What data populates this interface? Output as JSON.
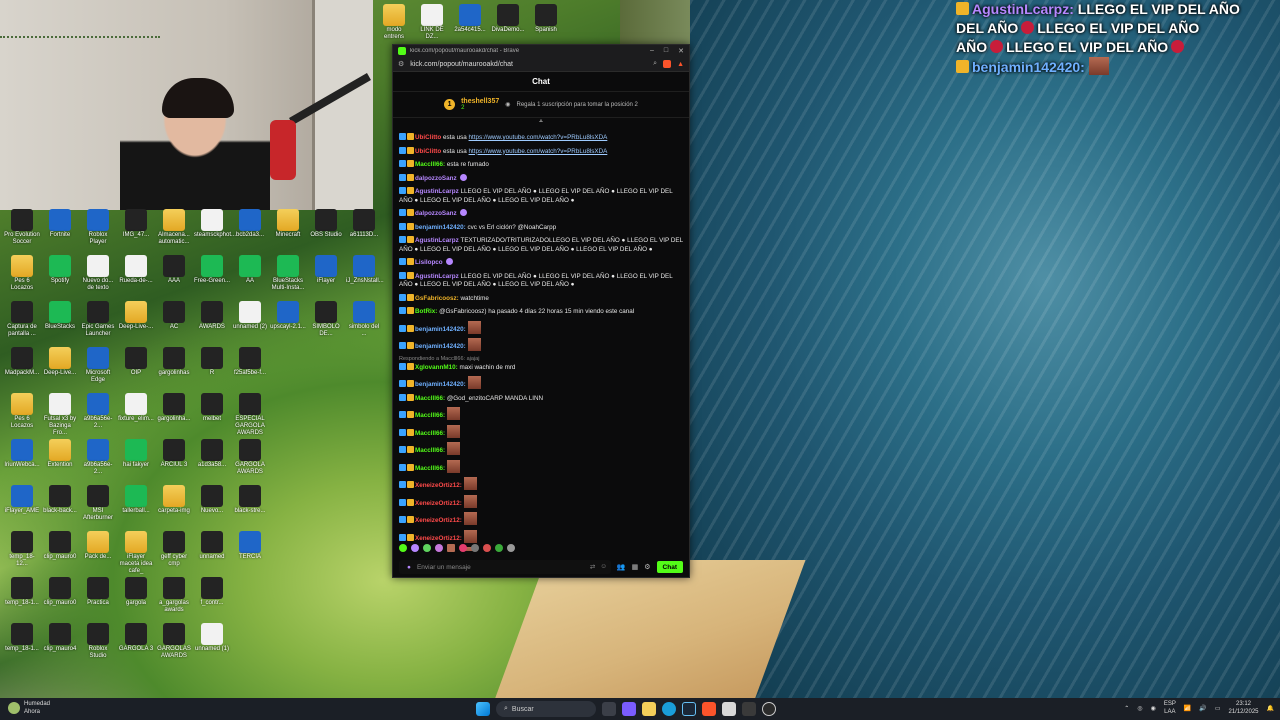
{
  "desktop": {
    "icons": [
      {
        "label": "Pro Evolution Soccer",
        "kind": "dark"
      },
      {
        "label": "Fortnite",
        "kind": "blue"
      },
      {
        "label": "Roblox Player",
        "kind": "blue"
      },
      {
        "label": "IMG_47...",
        "kind": "dark"
      },
      {
        "label": "Almacena... automatic...",
        "kind": "folder"
      },
      {
        "label": "steamsckphot...",
        "kind": "file"
      },
      {
        "label": "bcb2da3...",
        "kind": "blue"
      },
      {
        "label": "Minecraft",
        "kind": "folder"
      },
      {
        "label": "OBS Studio",
        "kind": "dark"
      },
      {
        "label": "a61113D...",
        "kind": "dark"
      },
      {
        "label": "Pes 6 Locazos",
        "kind": "folder"
      },
      {
        "label": "Spotify",
        "kind": "green"
      },
      {
        "label": "Nuevo do... de texto",
        "kind": "file"
      },
      {
        "label": "Rueda-de-...",
        "kind": "file"
      },
      {
        "label": "AAA",
        "kind": "dark"
      },
      {
        "label": "Free-Green...",
        "kind": "green"
      },
      {
        "label": "AA",
        "kind": "green"
      },
      {
        "label": "BlueStacks Multi-Insta...",
        "kind": "green"
      },
      {
        "label": "iFlayer",
        "kind": "blue"
      },
      {
        "label": "iJ_ZnsNstall...",
        "kind": "blue"
      },
      {
        "label": "Captura de pantalla ...",
        "kind": "dark"
      },
      {
        "label": "BlueStacks",
        "kind": "green"
      },
      {
        "label": "Epic Games Launcher",
        "kind": "dark"
      },
      {
        "label": "Deep-Live-...",
        "kind": "folder"
      },
      {
        "label": "AC",
        "kind": "dark"
      },
      {
        "label": "AWARDS",
        "kind": "dark"
      },
      {
        "label": "unnamed (2)",
        "kind": "file"
      },
      {
        "label": "upscayl-2.1...",
        "kind": "blue"
      },
      {
        "label": "SIMBOLO DE...",
        "kind": "dark"
      },
      {
        "label": "simbolo del ...",
        "kind": "blue"
      },
      {
        "label": "MadpackM...",
        "kind": "dark"
      },
      {
        "label": "Deep-Live...",
        "kind": "folder"
      },
      {
        "label": "Microsoft Edge",
        "kind": "blue"
      },
      {
        "label": "OIP",
        "kind": "dark"
      },
      {
        "label": "gargolinhas",
        "kind": "dark"
      },
      {
        "label": "R",
        "kind": "dark"
      },
      {
        "label": "f25af5be-f...",
        "kind": "dark"
      },
      {
        "label": "Pes 6 Locazos",
        "kind": "folder"
      },
      {
        "label": "Futsal x3 by Bazinga Fro...",
        "kind": "file"
      },
      {
        "label": "a9b6a56e-2...",
        "kind": "blue"
      },
      {
        "label": "fixture_elim...",
        "kind": "file"
      },
      {
        "label": "gargolinha...",
        "kind": "dark"
      },
      {
        "label": "melbet",
        "kind": "dark"
      },
      {
        "label": "ESPECIAL GARGOLA AWARDS",
        "kind": "dark"
      },
      {
        "label": "IriunWebca...",
        "kind": "blue"
      },
      {
        "label": "Extention",
        "kind": "folder"
      },
      {
        "label": "a9b6a56e-2...",
        "kind": "blue"
      },
      {
        "label": "hai fakyer",
        "kind": "green"
      },
      {
        "label": "ARCIUL 3",
        "kind": "dark"
      },
      {
        "label": "a1d3a58...",
        "kind": "dark"
      },
      {
        "label": "GARGOLA AWARDS",
        "kind": "dark"
      },
      {
        "label": "iFlayer_AME",
        "kind": "blue"
      },
      {
        "label": "black-back...",
        "kind": "dark"
      },
      {
        "label": "MSI Afterburner",
        "kind": "dark"
      },
      {
        "label": "tallerball...",
        "kind": "green"
      },
      {
        "label": "carpeta-img",
        "kind": "folder"
      },
      {
        "label": "Nuevo...",
        "kind": "dark"
      },
      {
        "label": "black-stre...",
        "kind": "dark"
      },
      {
        "label": "temp_18-12...",
        "kind": "dark"
      },
      {
        "label": "clip_mauro0",
        "kind": "dark"
      },
      {
        "label": "Pack de...",
        "kind": "folder"
      },
      {
        "label": "iFlayer maceta idea cafe_",
        "kind": "folder"
      },
      {
        "label": "geff cyber cmp",
        "kind": "dark"
      },
      {
        "label": "unnamed",
        "kind": "dark"
      },
      {
        "label": "TERCIA",
        "kind": "blue"
      },
      {
        "label": "temp_18-1...",
        "kind": "dark"
      },
      {
        "label": "clip_mauro0",
        "kind": "dark"
      },
      {
        "label": "Practica",
        "kind": "dark"
      },
      {
        "label": "gargola",
        "kind": "dark"
      },
      {
        "label": "a_gargolas awards",
        "kind": "dark"
      },
      {
        "label": "f_contr...",
        "kind": "dark"
      },
      {
        "label": "temp_18-1...",
        "kind": "dark"
      },
      {
        "label": "clip_mauro4",
        "kind": "dark"
      },
      {
        "label": "Roblox Studio",
        "kind": "dark"
      },
      {
        "label": "GARGOLA 3",
        "kind": "dark"
      },
      {
        "label": "GARGOLAS AWARDS",
        "kind": "dark"
      },
      {
        "label": "unnamed (1)",
        "kind": "file"
      }
    ],
    "top_icons": [
      {
        "label": "modo entrens",
        "kind": "folder"
      },
      {
        "label": "LINK DE DZ...",
        "kind": "file"
      },
      {
        "label": "2a54c415...",
        "kind": "blue"
      },
      {
        "label": "DivaDemo...",
        "kind": "dark"
      },
      {
        "label": "Spanish",
        "kind": "dark"
      }
    ]
  },
  "browser": {
    "title": "kick.com/popout/maurooakd/chat - Brave",
    "url": "kick.com/popout/maurooakd/chat",
    "chat_header": "Chat",
    "pinned": {
      "position": "1",
      "username": "theshell357",
      "subs": "2",
      "text": "Regala 1 suscripción para tomar la posición 2"
    },
    "messages": [
      {
        "user": "UbiClitto",
        "color": "#ff4a4a",
        "text": "esta usa",
        "link": "https://www.youtube.com/watch?v=PRbLu8lsXDA"
      },
      {
        "user": "UbiClitto",
        "color": "#ff4a4a",
        "text": "esta usa",
        "link": "https://www.youtube.com/watch?v=PRbLu8lsXDA"
      },
      {
        "user": "Macclll66:",
        "color": "#53fc18",
        "text": "esta re fumado"
      },
      {
        "user": "dalpozzoSanz",
        "color": "#b687ff",
        "text": ""
      },
      {
        "user": "AgustinLcarpz",
        "color": "#b687ff",
        "text": "LLEGO EL VIP DEL AÑO ● LLEGO EL VIP DEL AÑO ● LLEGO EL VIP DEL AÑO ● LLEGO EL VIP DEL AÑO ● LLEGO EL VIP DEL AÑO ●"
      },
      {
        "user": "dalpozzoSanz",
        "color": "#b687ff",
        "text": ""
      },
      {
        "user": "benjamin142420:",
        "color": "#6fb0ff",
        "text": "cvc vs Erl ciclón? @NoahCarpp"
      },
      {
        "user": "AgustinLcarpz",
        "color": "#b687ff",
        "text": "TEXTURIZADO/TRITURIZADOLLEGO EL VIP DEL AÑO ● LLEGO EL VIP DEL AÑO ● LLEGO EL VIP DEL AÑO ● LLEGO EL VIP DEL AÑO ● LLEGO EL VIP DEL AÑO ●"
      },
      {
        "user": "Lisilopco",
        "color": "#b687ff",
        "text": ""
      },
      {
        "user": "AgustinLcarpz",
        "color": "#b687ff",
        "text": "LLEGO EL VIP DEL AÑO ● LLEGO EL VIP DEL AÑO ● LLEGO EL VIP DEL AÑO ● LLEGO EL VIP DEL AÑO ● LLEGO EL VIP DEL AÑO ●"
      },
      {
        "user": "GsFabricoosz:",
        "color": "#f0b429",
        "text": "watchtime"
      },
      {
        "user": "BotRix:",
        "color": "#53fc18",
        "text": "@GsFabricoosz) ha pasado 4 días 22 horas 15 min viendo este canal"
      },
      {
        "user": "benjamin142420:",
        "color": "#6fb0ff",
        "text": "",
        "img": true
      },
      {
        "user": "benjamin142420:",
        "color": "#6fb0ff",
        "text": "",
        "img": true
      },
      {
        "reply": "Respondiendo a Macclll66: ajajaj",
        "user": "XglovannM10:",
        "color": "#53fc18",
        "text": "maxi wachin de mrd"
      },
      {
        "user": "benjamin142420:",
        "color": "#6fb0ff",
        "text": "",
        "img": true
      },
      {
        "user": "Macclll66:",
        "color": "#53fc18",
        "text": "@God_enzitoCARP MANDA LINN"
      },
      {
        "user": "Macclll66:",
        "color": "#53fc18",
        "text": "",
        "img": true
      },
      {
        "user": "Macclll66:",
        "color": "#53fc18",
        "text": "",
        "img": true
      },
      {
        "user": "Macclll66:",
        "color": "#53fc18",
        "text": "",
        "img": true
      },
      {
        "user": "Macclll66:",
        "color": "#53fc18",
        "text": "",
        "img": true
      },
      {
        "user": "XeneizeOrtiz12:",
        "color": "#ff4a4a",
        "text": "",
        "img": true
      },
      {
        "user": "XeneizeOrtiz12:",
        "color": "#ff4a4a",
        "text": "",
        "img": true
      },
      {
        "user": "XeneizeOrtiz12:",
        "color": "#ff4a4a",
        "text": "",
        "img": true
      },
      {
        "user": "XeneizeOrtiz12:",
        "color": "#ff4a4a",
        "text": "",
        "img": true
      },
      {
        "user": "XeneizeOrtiz12:",
        "color": "#ff4a4a",
        "text": "",
        "img": true
      },
      {
        "user": "AgustinLcarpz",
        "color": "#b687ff",
        "text": "LLEGO EL VIP DEL AÑO ● LLEGO EL VIP DEL AÑO ● LLEGO EL VIP DEL AÑO ● LLEGO EL VIP DEL AÑO ● LLEGO EL VIP DEL AÑO ●"
      },
      {
        "user": "benjamin142420:",
        "color": "#6fb0ff",
        "text": "",
        "img": true
      }
    ],
    "input_placeholder": "Enviar un mensaje",
    "chat_button": "Chat"
  },
  "overlay": {
    "line1_user": "AgustinLcarpz:",
    "line1_text": "LLEGO EL VIP DEL AÑO",
    "line2_text": "DEL AÑO",
    "line2b": "LLEGO EL VIP DEL AÑO",
    "line3_text": "AÑO",
    "line3b": "LLEGO EL VIP DEL AÑO",
    "line4_user": "benjamin142420:"
  },
  "taskbar": {
    "weather_title": "Humedad",
    "weather_sub": "Ahora",
    "search": "Buscar",
    "lang1": "ESP",
    "lang2": "LAA",
    "time": "23:12",
    "date": "21/12/2025"
  },
  "colors": {
    "kick_green": "#53fc18",
    "taskbar": "#1b1f26"
  }
}
